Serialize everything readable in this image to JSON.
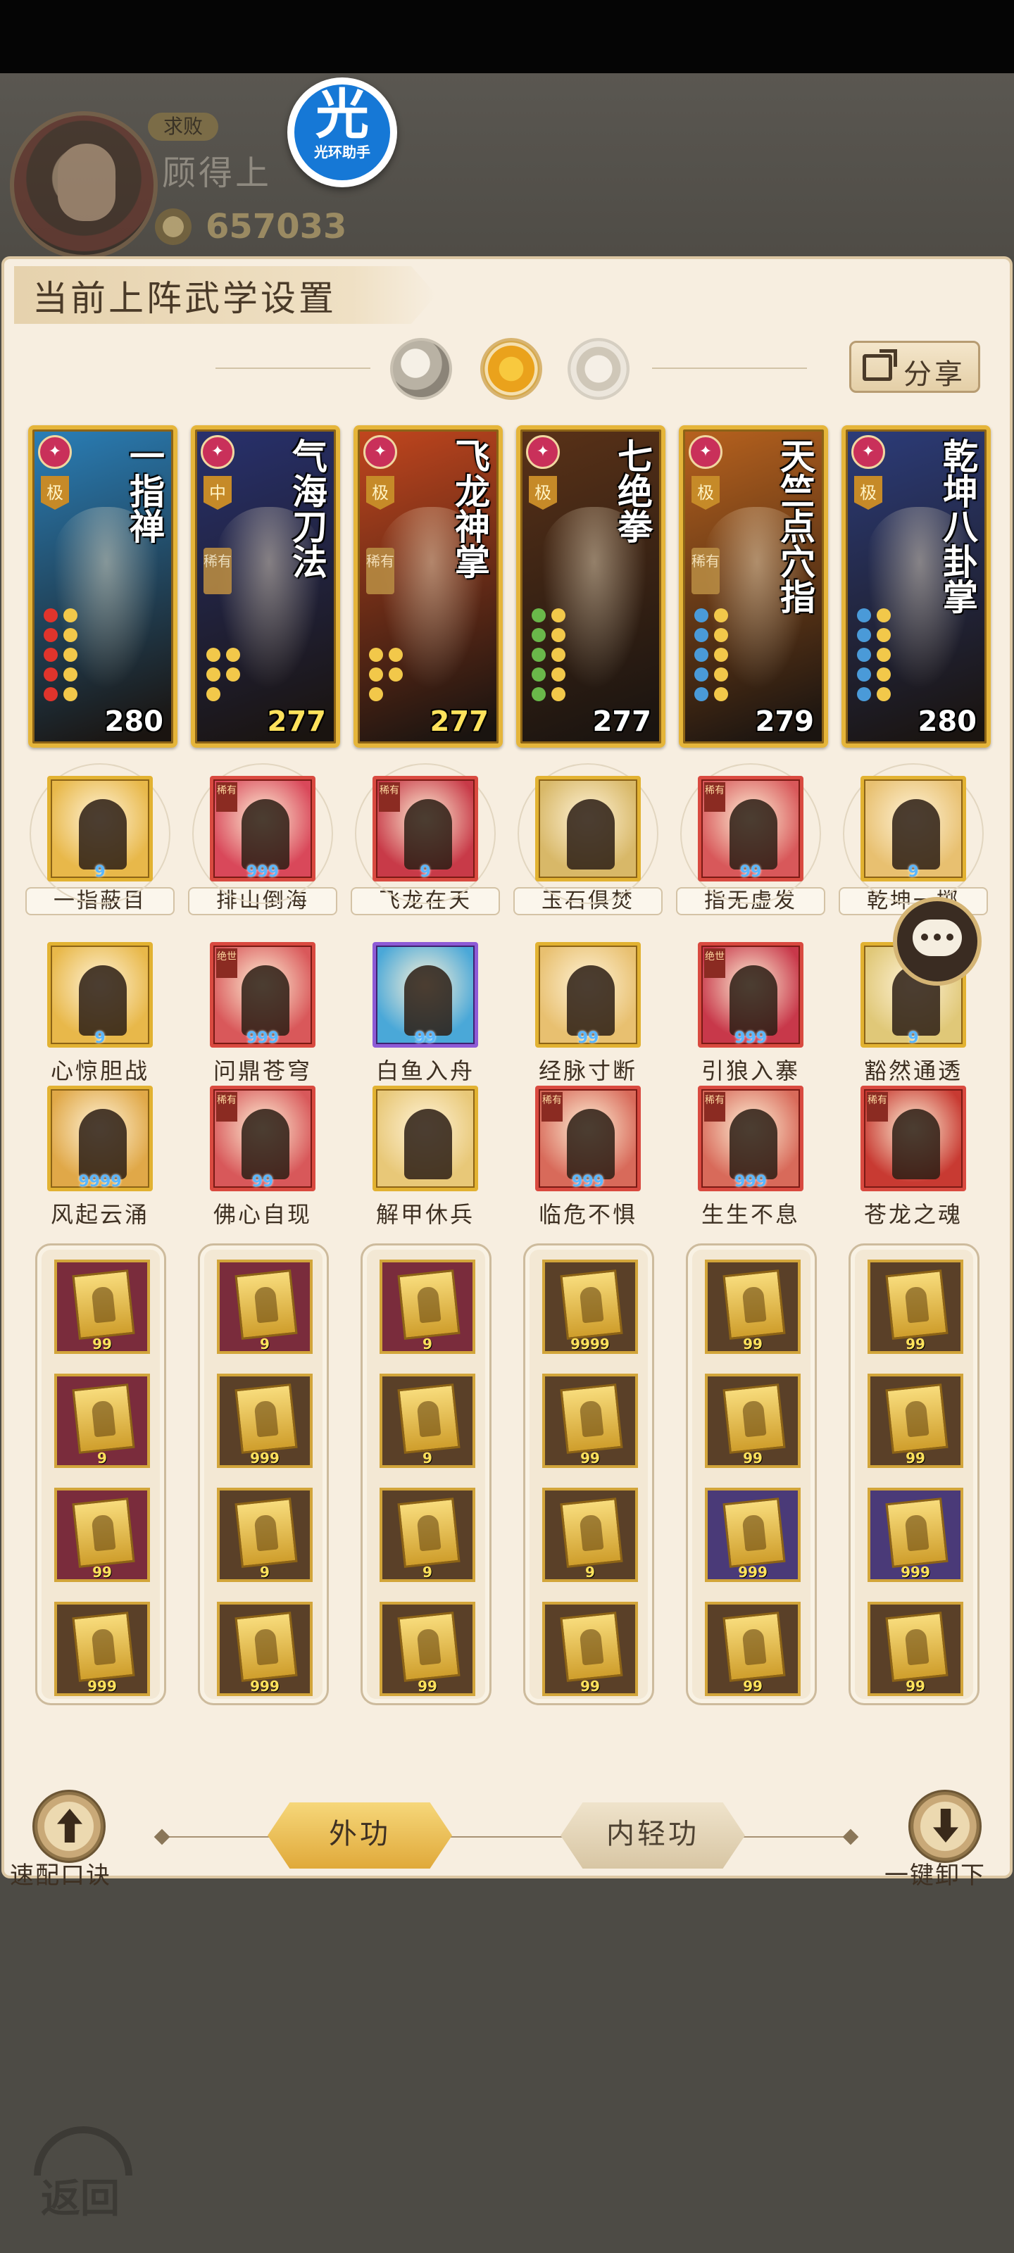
{
  "player": {
    "rank": "求败",
    "name": "顾得上",
    "power": "657033"
  },
  "overlay_badge": {
    "glyph": "光",
    "label": "光环助手"
  },
  "panel": {
    "title": "当前上阵武学设置",
    "share_label": "分享"
  },
  "cards": [
    {
      "name": "一指禅",
      "tier": "极",
      "rare": "",
      "level": "280",
      "level_color": "white",
      "bg": "#2a7fb8",
      "dots": [
        "#e0342c",
        "#f2c84a",
        "#e0342c",
        "#f2c84a",
        "#e0342c",
        "#f2c84a",
        "#e0342c",
        "#f2c84a",
        "#e0342c",
        "#f2c84a"
      ],
      "kind_color": "#c9305a"
    },
    {
      "name": "气海刀法",
      "tier": "中",
      "rare": "稀有",
      "level": "277",
      "level_color": "gold",
      "bg": "#28316e",
      "dots": [
        "#f2c84a",
        "#f2c84a",
        "#f2c84a",
        "#f2c84a",
        "#f2c84a"
      ],
      "kind_color": "#c9305a"
    },
    {
      "name": "飞龙神掌",
      "tier": "极",
      "rare": "稀有",
      "level": "277",
      "level_color": "gold",
      "bg": "#c2461e",
      "dots": [
        "#f2c84a",
        "#f2c84a",
        "#f2c84a",
        "#f2c84a",
        "#f2c84a"
      ],
      "kind_color": "#c9305a"
    },
    {
      "name": "七绝拳",
      "tier": "极",
      "rare": "",
      "level": "277",
      "level_color": "white",
      "bg": "#5a3218",
      "dots": [
        "#6ab84a",
        "#f2c84a",
        "#6ab84a",
        "#f2c84a",
        "#6ab84a",
        "#f2c84a",
        "#6ab84a",
        "#f2c84a",
        "#6ab84a",
        "#f2c84a"
      ],
      "kind_color": "#c9305a"
    },
    {
      "name": "天竺点穴指",
      "tier": "极",
      "rare": "稀有",
      "level": "279",
      "level_color": "white",
      "bg": "#b8621e",
      "dots": [
        "#4a9ad8",
        "#f2c84a",
        "#4a9ad8",
        "#f2c84a",
        "#4a9ad8",
        "#f2c84a",
        "#4a9ad8",
        "#f2c84a",
        "#4a9ad8",
        "#f2c84a"
      ],
      "kind_color": "#c9305a"
    },
    {
      "name": "乾坤八卦掌",
      "tier": "极",
      "rare": "",
      "level": "280",
      "level_color": "white",
      "bg": "#2c3c7a",
      "dots": [
        "#4a9ad8",
        "#f2c84a",
        "#4a9ad8",
        "#f2c84a",
        "#4a9ad8",
        "#f2c84a",
        "#4a9ad8",
        "#f2c84a",
        "#4a9ad8",
        "#f2c84a"
      ],
      "kind_color": "#c9305a"
    }
  ],
  "skill_rows": [
    [
      {
        "label": "一指蔽目",
        "frame": "gold",
        "bg": "#e8b84a",
        "tag": "",
        "count": "9"
      },
      {
        "label": "排山倒海",
        "frame": "red",
        "bg": "#d9485a",
        "tag": "稀有",
        "count": "999"
      },
      {
        "label": "飞龙在天",
        "frame": "red",
        "bg": "#c83a48",
        "tag": "稀有",
        "count": "9"
      },
      {
        "label": "玉石俱焚",
        "frame": "gold",
        "bg": "#d8b868",
        "tag": "",
        "count": ""
      },
      {
        "label": "指无虚发",
        "frame": "red",
        "bg": "#d8585a",
        "tag": "稀有",
        "count": "99"
      },
      {
        "label": "乾坤一掷",
        "frame": "gold",
        "bg": "#e8c070",
        "tag": "",
        "count": "9"
      }
    ],
    [
      {
        "label": "心惊胆战",
        "frame": "gold",
        "bg": "#e8b84a",
        "tag": "",
        "count": "9"
      },
      {
        "label": "问鼎苍穹",
        "frame": "red",
        "bg": "#d9585a",
        "tag": "绝世",
        "count": "999"
      },
      {
        "label": "白鱼入舟",
        "frame": "purple",
        "bg": "#4aa8d8",
        "tag": "",
        "count": "99"
      },
      {
        "label": "经脉寸断",
        "frame": "gold",
        "bg": "#e8c070",
        "tag": "",
        "count": "99"
      },
      {
        "label": "引狼入寨",
        "frame": "red",
        "bg": "#c8384a",
        "tag": "绝世",
        "count": "999"
      },
      {
        "label": "豁然通透",
        "frame": "gold",
        "bg": "#e0c878",
        "tag": "",
        "count": "9"
      }
    ],
    [
      {
        "label": "风起云涌",
        "frame": "gold",
        "bg": "#e0a848",
        "tag": "",
        "count": "9999"
      },
      {
        "label": "佛心自现",
        "frame": "red",
        "bg": "#d8585a",
        "tag": "稀有",
        "count": "99"
      },
      {
        "label": "解甲休兵",
        "frame": "gold",
        "bg": "#e8c878",
        "tag": "",
        "count": ""
      },
      {
        "label": "临危不惧",
        "frame": "red",
        "bg": "#d86a5a",
        "tag": "稀有",
        "count": "999"
      },
      {
        "label": "生生不息",
        "frame": "red",
        "bg": "#d86a5a",
        "tag": "稀有",
        "count": "999"
      },
      {
        "label": "苍龙之魂",
        "frame": "red",
        "bg": "#c83a32",
        "tag": "稀有",
        "count": ""
      }
    ]
  ],
  "slot_columns": [
    [
      {
        "bg": "red",
        "count": "99"
      },
      {
        "bg": "red",
        "count": "9"
      },
      {
        "bg": "red",
        "count": "99"
      },
      {
        "bg": "dark",
        "count": "999"
      }
    ],
    [
      {
        "bg": "red",
        "count": "9"
      },
      {
        "bg": "dark",
        "count": "999"
      },
      {
        "bg": "dark",
        "count": "9"
      },
      {
        "bg": "dark",
        "count": "999"
      }
    ],
    [
      {
        "bg": "red",
        "count": "9"
      },
      {
        "bg": "dark",
        "count": "9"
      },
      {
        "bg": "dark",
        "count": "9"
      },
      {
        "bg": "dark",
        "count": "99"
      }
    ],
    [
      {
        "bg": "dark",
        "count": "9999"
      },
      {
        "bg": "dark",
        "count": "99"
      },
      {
        "bg": "dark",
        "count": "9"
      },
      {
        "bg": "dark",
        "count": "99"
      }
    ],
    [
      {
        "bg": "dark",
        "count": "99"
      },
      {
        "bg": "dark",
        "count": "99"
      },
      {
        "bg": "purple",
        "count": "999"
      },
      {
        "bg": "dark",
        "count": "99"
      }
    ],
    [
      {
        "bg": "dark",
        "count": "99"
      },
      {
        "bg": "dark",
        "count": "99"
      },
      {
        "bg": "purple",
        "count": "999"
      },
      {
        "bg": "dark",
        "count": "99"
      }
    ]
  ],
  "bottom": {
    "left_button_label": "速配口诀",
    "right_button_label": "一键卸下",
    "tab_outer": "外功",
    "tab_inner": "内轻功"
  },
  "back": {
    "label": "返回"
  }
}
